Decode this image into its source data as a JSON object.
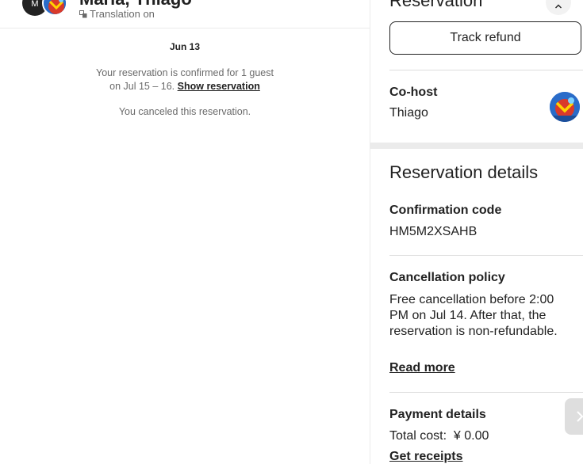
{
  "chat": {
    "avatar_initial": "M",
    "title": "Maria, Thiago",
    "translation": "Translation on",
    "date": "Jun 13",
    "confirmed_text": "Your reservation is confirmed for 1 guest on Jul 15 – 16.",
    "show_reservation_link": "Show reservation",
    "canceled_text": "You canceled this reservation."
  },
  "side": {
    "title": "Reservation",
    "track_refund_label": "Track refund",
    "cohost": {
      "label": "Co-host",
      "name": "Thiago"
    },
    "details_title": "Reservation details",
    "confirmation": {
      "label": "Confirmation code",
      "value": "HM5M2XSAHB"
    },
    "cancellation": {
      "label": "Cancellation policy",
      "value": "Free cancellation before 2:00 PM on Jul 14. After that, the reservation is non-refundable.",
      "read_more": "Read more"
    },
    "payment": {
      "label": "Payment details",
      "total": "Total cost:  ¥ 0.00",
      "get_receipts": "Get receipts"
    }
  },
  "icons": {
    "translate": "translate-icon",
    "close": "chevron-up-icon",
    "scroll": "chevron-right-icon"
  },
  "colors": {
    "text": "#222222",
    "muted": "#6a6a6a",
    "divider": "#dddddd"
  }
}
